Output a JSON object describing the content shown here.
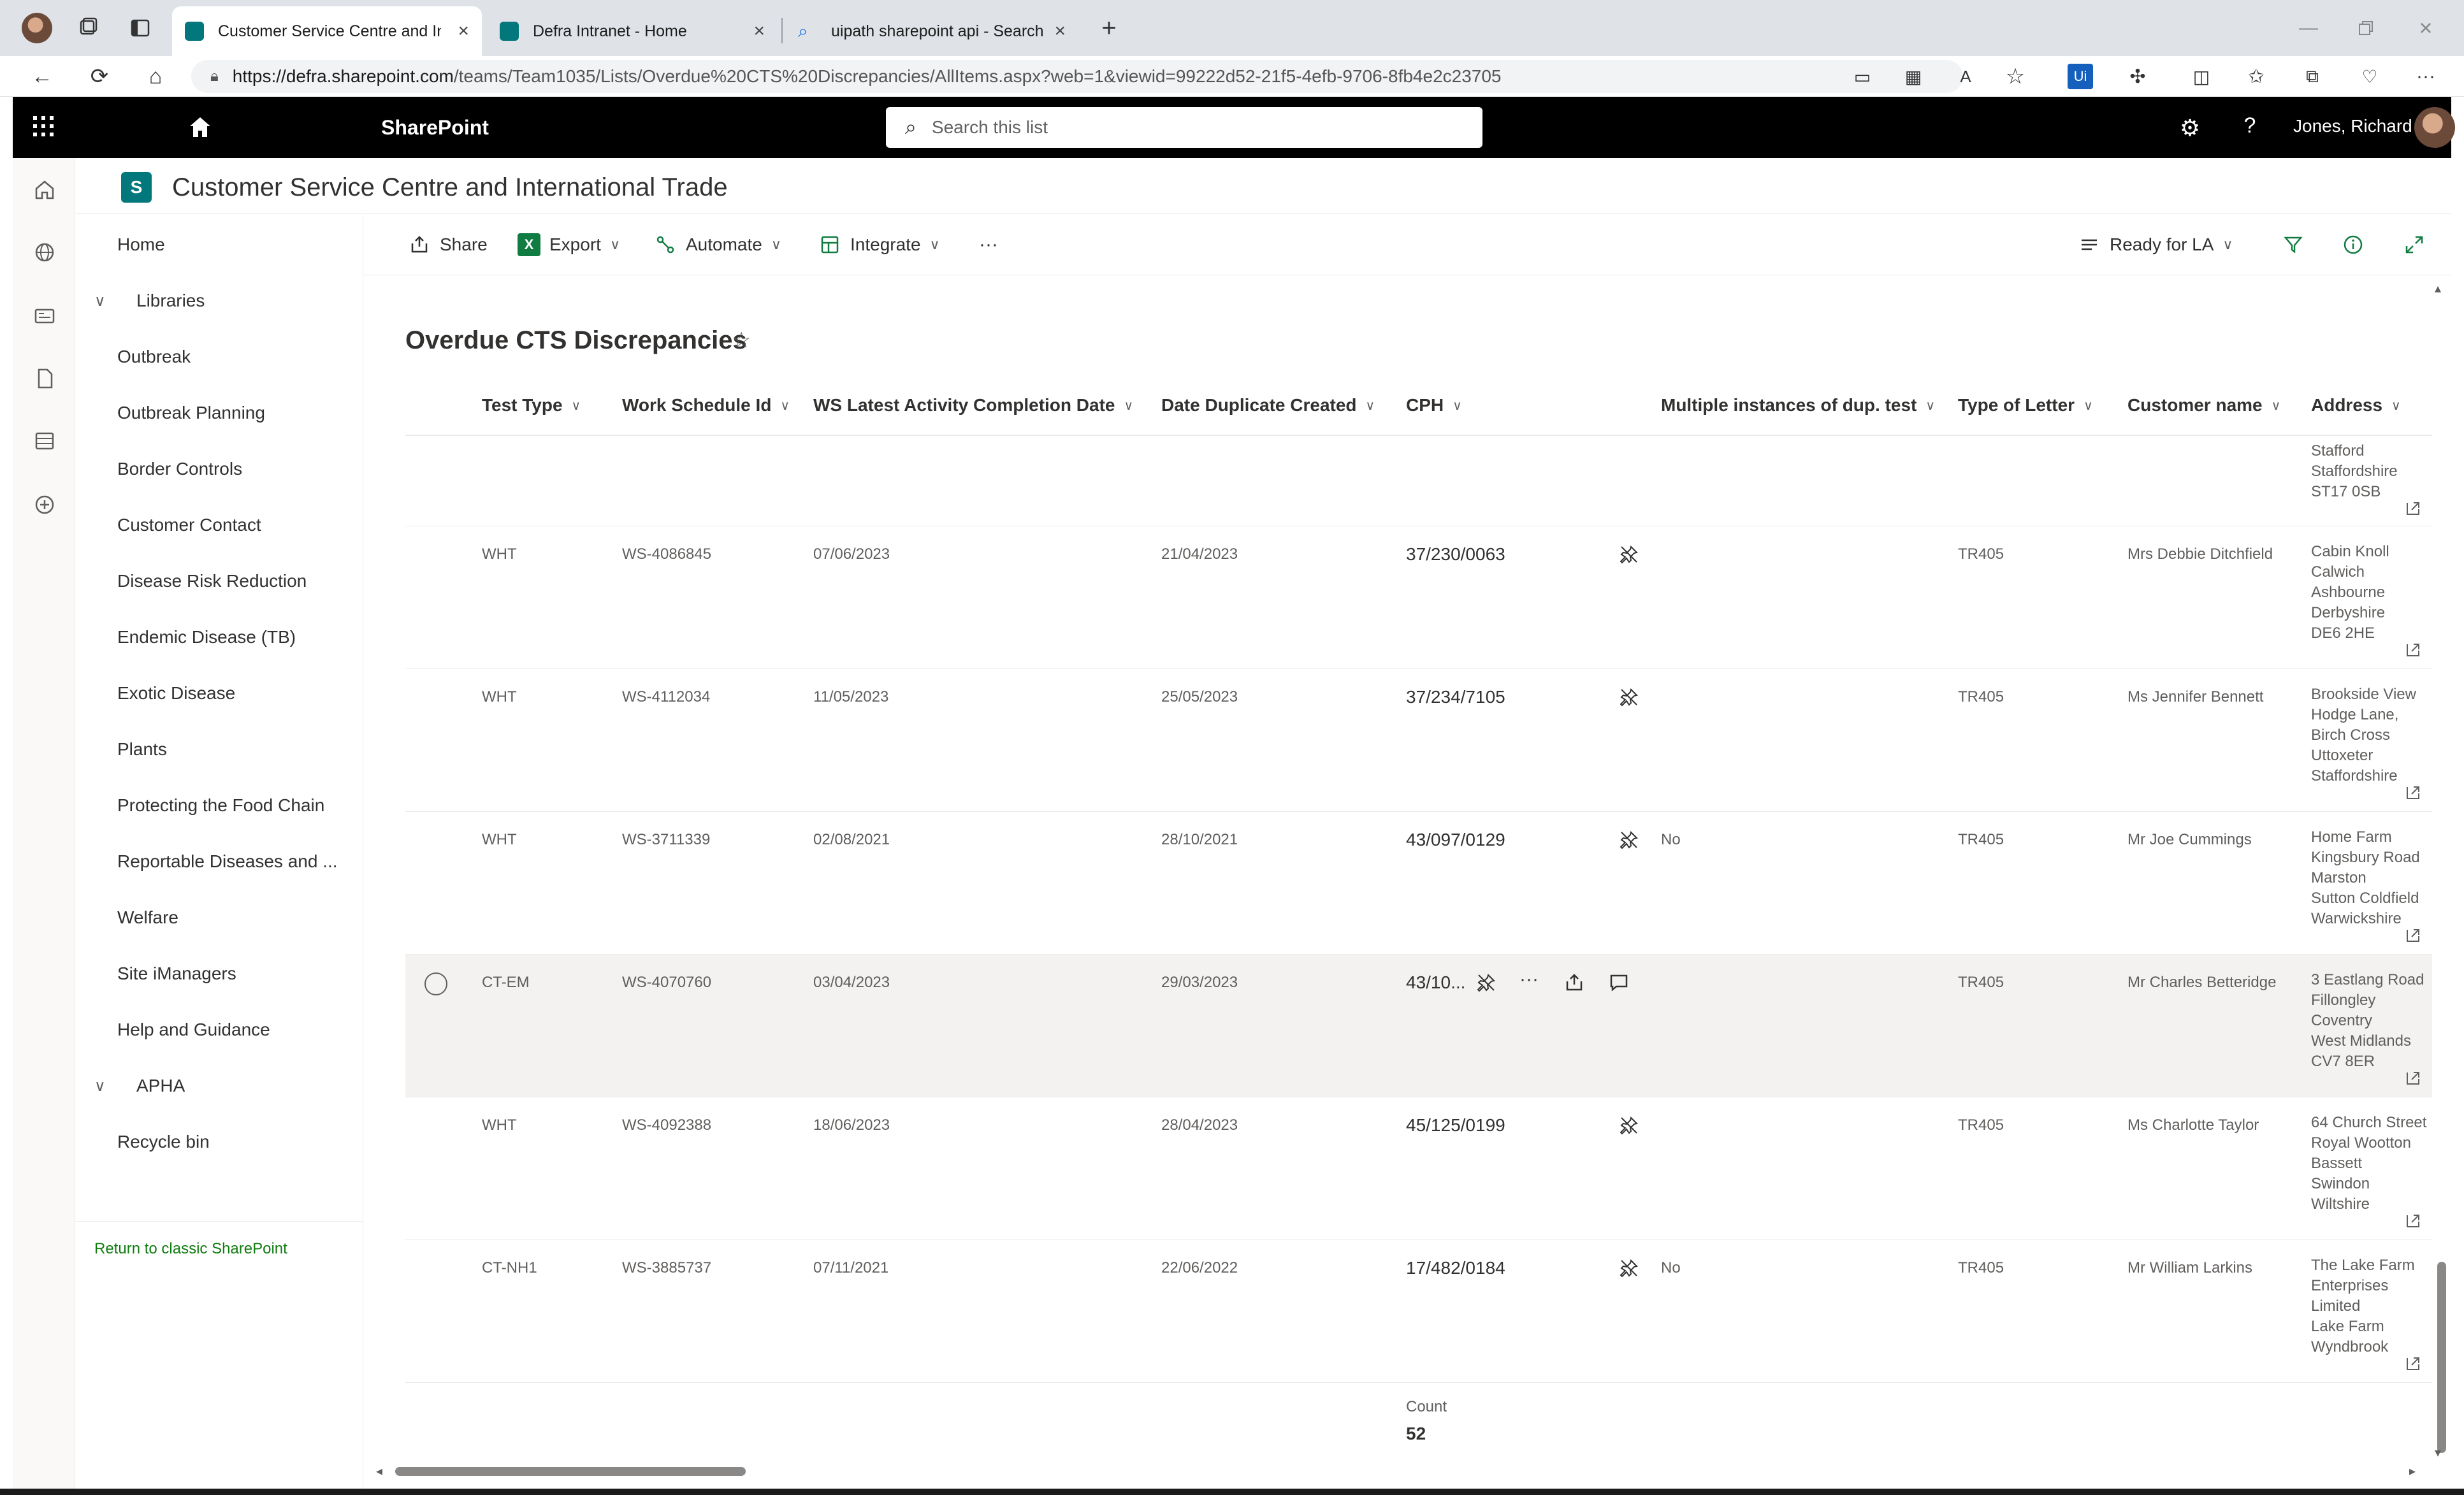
{
  "browser": {
    "tabs": [
      {
        "label": "Customer Service Centre and Inte",
        "active": true
      },
      {
        "label": "Defra Intranet - Home",
        "active": false
      },
      {
        "label": "uipath sharepoint api - Search",
        "active": false
      }
    ],
    "url_host": "https://defra.sharepoint.com",
    "url_path": "/teams/Team1035/Lists/Overdue%20CTS%20Discrepancies/AllItems.aspx?web=1&viewid=99222d52-21f5-4efb-9706-8fb4e2c23705"
  },
  "suite": {
    "app_name": "SharePoint",
    "search_placeholder": "Search this list",
    "user_name": "Jones, Richard"
  },
  "site": {
    "logo_letter": "S",
    "title": "Customer Service Centre and International Trade"
  },
  "nav": {
    "home": "Home",
    "libraries": "Libraries",
    "items": [
      "Outbreak",
      "Outbreak Planning",
      "Border Controls",
      "Customer Contact",
      "Disease Risk Reduction",
      "Endemic Disease (TB)",
      "Exotic Disease",
      "Plants",
      "Protecting the Food Chain",
      "Reportable Diseases and ...",
      "Welfare",
      "Site iManagers",
      "Help and Guidance"
    ],
    "apha": "APHA",
    "recycle_bin": "Recycle bin",
    "classic_link": "Return to classic SharePoint"
  },
  "commands": {
    "share": "Share",
    "export": "Export",
    "automate": "Automate",
    "integrate": "Integrate",
    "more": "···",
    "view": "Ready for LA"
  },
  "list": {
    "title": "Overdue CTS Discrepancies",
    "columns": [
      "Test Type",
      "Work Schedule Id",
      "WS Latest Activity Completion Date",
      "Date Duplicate Created",
      "CPH",
      "Multiple instances of dup. test",
      "Type of Letter",
      "Customer name",
      "Address"
    ],
    "partial_row_address": [
      "Stafford",
      "Staffordshire",
      "ST17 0SB"
    ],
    "rows": [
      {
        "test_type": "WHT",
        "ws_id": "WS-4086845",
        "ws_date": "07/06/2023",
        "dup_date": "21/04/2023",
        "cph": "37/230/0063",
        "multiple": "",
        "letter": "TR405",
        "customer": "Mrs Debbie Ditchfield",
        "address": [
          "Cabin Knoll",
          "Calwich",
          "Ashbourne",
          "Derbyshire",
          "DE6 2HE"
        ]
      },
      {
        "test_type": "WHT",
        "ws_id": "WS-4112034",
        "ws_date": "11/05/2023",
        "dup_date": "25/05/2023",
        "cph": "37/234/7105",
        "multiple": "",
        "letter": "TR405",
        "customer": "Ms Jennifer Bennett",
        "address": [
          "Brookside View",
          "Hodge Lane,",
          "Birch Cross",
          "Uttoxeter",
          "Staffordshire"
        ]
      },
      {
        "test_type": "WHT",
        "ws_id": "WS-3711339",
        "ws_date": "02/08/2021",
        "dup_date": "28/10/2021",
        "cph": "43/097/0129",
        "multiple": "No",
        "letter": "TR405",
        "customer": "Mr Joe Cummings",
        "address": [
          "Home Farm",
          "Kingsbury Road",
          "Marston",
          "Sutton Coldfield",
          "Warwickshire"
        ]
      },
      {
        "test_type": "CT-EM",
        "ws_id": "WS-4070760",
        "ws_date": "03/04/2023",
        "dup_date": "29/03/2023",
        "cph": "43/10...",
        "multiple": "",
        "letter": "TR405",
        "customer": "Mr Charles Betteridge",
        "address": [
          "3 Eastlang Road",
          "Fillongley",
          "Coventry",
          "West Midlands",
          "CV7 8ER"
        ],
        "selected": true
      },
      {
        "test_type": "WHT",
        "ws_id": "WS-4092388",
        "ws_date": "18/06/2023",
        "dup_date": "28/04/2023",
        "cph": "45/125/0199",
        "multiple": "",
        "letter": "TR405",
        "customer": "Ms Charlotte Taylor",
        "address": [
          "64 Church Street",
          "Royal Wootton",
          "Bassett",
          "Swindon",
          "Wiltshire"
        ]
      },
      {
        "test_type": "CT-NH1",
        "ws_id": "WS-3885737",
        "ws_date": "07/11/2021",
        "dup_date": "22/06/2022",
        "cph": "17/482/0184",
        "multiple": "No",
        "letter": "TR405",
        "customer": "Mr William Larkins",
        "address": [
          "The Lake Farm",
          "Enterprises",
          "Limited",
          "Lake Farm",
          "Wyndbrook"
        ]
      }
    ],
    "count_label": "Count",
    "count_value": "52"
  }
}
